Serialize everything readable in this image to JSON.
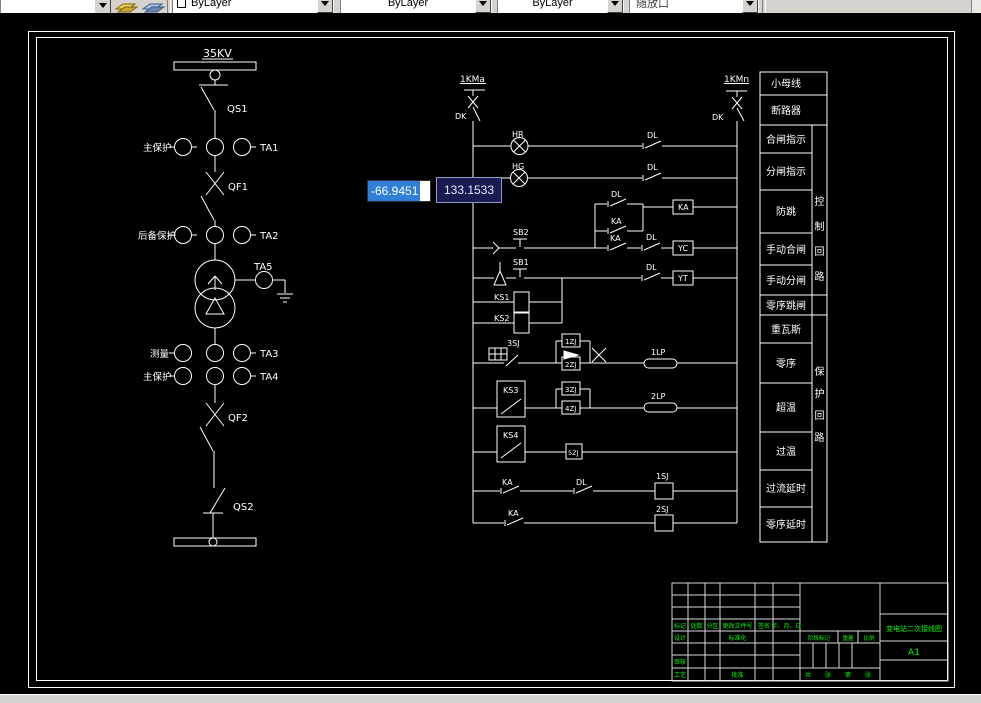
{
  "toolbar": {
    "color_value": "ByLayer",
    "linetype_value": "ByLayer",
    "lineweight_value": "ByLayer",
    "plotstyle_value": "随放口"
  },
  "tooltip": {
    "x_value": "-66.9451",
    "y_value": "133.1533"
  },
  "oneline": {
    "voltage_label": "35KV",
    "qs1": "QS1",
    "qf1": "QF1",
    "qf2": "QF2",
    "qs2": "QS2",
    "ta1": "TA1",
    "ta2": "TA2",
    "ta3": "TA3",
    "ta4": "TA4",
    "ta5": "TA5",
    "main_protection": "主保护",
    "backup_protection": "后备保护",
    "measurement": "测量"
  },
  "circuit": {
    "bus_left": "1KMa",
    "bus_right": "1KMn",
    "dk": "DK",
    "hr": "HR",
    "hg": "HG",
    "dl": "DL",
    "ka": "KA",
    "yc": "YC",
    "yt": "YT",
    "sb1": "SB1",
    "sb2": "SB2",
    "ks1": "KS1",
    "ks2": "KS2",
    "ks3": "KS3",
    "ks4": "KS4",
    "sj3": "3SJ",
    "sj1": "1SJ",
    "sj2": "2SJ",
    "zj1": "1ZJ",
    "zj2": "2ZJ",
    "zj3": "3ZJ",
    "zj4": "4ZJ",
    "zj5": "5ZJ",
    "lp1": "1LP",
    "lp2": "2LP"
  },
  "panel": {
    "rows": [
      "小母线",
      "断路器",
      "合闸指示",
      "分闸指示",
      "防跳",
      "手动合闸",
      "手动分闸",
      "零序跳闸",
      "重瓦斯",
      "零序",
      "超温",
      "过温",
      "过流延时",
      "零序延时"
    ],
    "control_chars": [
      "控",
      "制",
      "回",
      "路"
    ],
    "protection_chars": [
      "保",
      "护",
      "回",
      "路"
    ]
  },
  "title_block": {
    "header_cells": [
      "标记",
      "处数",
      "分区",
      "更改文件号",
      "签名",
      "年、月、日"
    ],
    "design": "设计",
    "standardize": "标准化",
    "review": "审核",
    "craft": "工艺",
    "approve": "批准",
    "stage_mark": "阶段标记",
    "weight": "重量",
    "scale": "比例",
    "sheet_cells": [
      "共",
      "张",
      "第",
      "张"
    ],
    "drawing_title": "变电站二次接线图",
    "paper_size": "A1"
  },
  "colors": {
    "canvas_bg": "#000000",
    "cad_line": "#ffffff",
    "titleblock_text": "#00ff00",
    "tooltip_selection": "#2f7fd7",
    "tooltip_inactive_bg": "#1a1a52",
    "toolbar_bg": "#d6d3ce"
  }
}
